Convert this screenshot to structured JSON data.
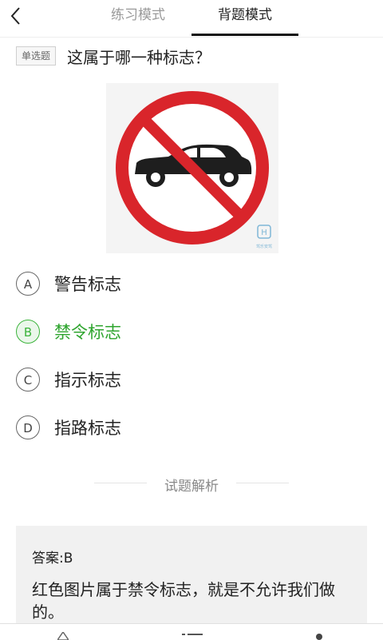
{
  "header": {
    "tabs": [
      {
        "label": "练习模式",
        "active": false
      },
      {
        "label": "背题模式",
        "active": true
      }
    ]
  },
  "question": {
    "type_badge": "单选题",
    "text": "这属于哪一种标志？",
    "image": {
      "icon": "no-motor-vehicles-sign",
      "watermark": "驾乐安驾"
    }
  },
  "options": [
    {
      "letter": "A",
      "text": "警告标志",
      "correct": false
    },
    {
      "letter": "B",
      "text": "禁令标志",
      "correct": true
    },
    {
      "letter": "C",
      "text": "指示标志",
      "correct": false
    },
    {
      "letter": "D",
      "text": "指路标志",
      "correct": false
    }
  ],
  "analysis": {
    "title": "试题解析",
    "answer_label": "答案:B",
    "explanation": "红色图片属于禁令标志，就是不允许我们做的。"
  },
  "colors": {
    "correct": "#2fa52f",
    "sign_red": "#d9252b",
    "answer_bg": "#f1f1f1"
  },
  "bottom_bar": {
    "icons": [
      "warning-icon",
      "list-icon",
      "person-icon"
    ]
  }
}
